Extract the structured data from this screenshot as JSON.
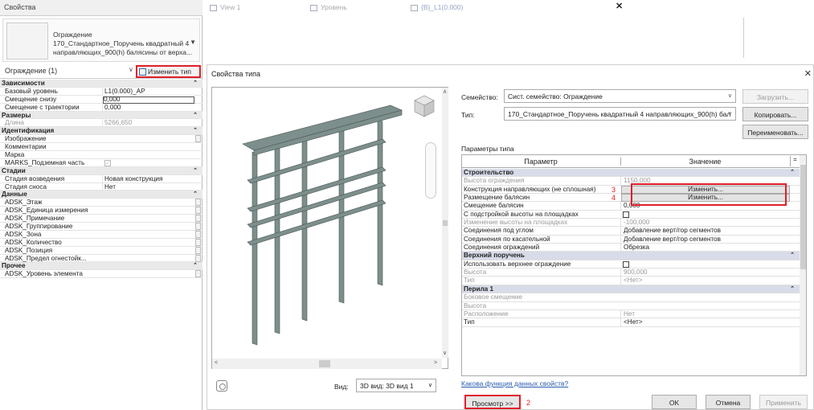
{
  "properties_palette": {
    "title": "Свойства",
    "type_selector": {
      "family": "Ограждение",
      "type_line1": "170_Стандартное_Поручень квадратный 4",
      "type_line2": "направляющих_900(h) балясины от верха..."
    },
    "filter": "Ограждение (1)",
    "edit_type_label": "Изменить тип",
    "edit_type_annotation": "1",
    "rows": [
      {
        "kind": "cat",
        "label": "Зависимости"
      },
      {
        "kind": "row",
        "label": "Базовый уровень",
        "value": "L1(0.000)_AP"
      },
      {
        "kind": "box",
        "label": "Смещение снизу",
        "value": "0,000"
      },
      {
        "kind": "row",
        "label": "Смещение с траектории",
        "value": "0,000"
      },
      {
        "kind": "cat",
        "label": "Размеры"
      },
      {
        "kind": "gray",
        "label": "Длина",
        "value": "5266,650"
      },
      {
        "kind": "cat",
        "label": "Идентификация"
      },
      {
        "kind": "btn",
        "label": "Изображение",
        "value": ""
      },
      {
        "kind": "row",
        "label": "Комментарии",
        "value": ""
      },
      {
        "kind": "row",
        "label": "Марка",
        "value": ""
      },
      {
        "kind": "chk",
        "label": "MARKS_Подземная часть",
        "value": "✓"
      },
      {
        "kind": "cat",
        "label": "Стадии"
      },
      {
        "kind": "row",
        "label": "Стадия возведения",
        "value": "Новая конструкция"
      },
      {
        "kind": "row",
        "label": "Стадия сноса",
        "value": "Нет"
      },
      {
        "kind": "cat",
        "label": "Данные"
      },
      {
        "kind": "btn",
        "label": "ADSK_Этаж",
        "value": ""
      },
      {
        "kind": "btn",
        "label": "ADSK_Единица измерения",
        "value": ""
      },
      {
        "kind": "btn",
        "label": "ADSK_Примечание",
        "value": ""
      },
      {
        "kind": "btn",
        "label": "ADSK_Группирование",
        "value": ""
      },
      {
        "kind": "btn",
        "label": "ADSK_Зона",
        "value": ""
      },
      {
        "kind": "btn",
        "label": "ADSK_Количество",
        "value": ""
      },
      {
        "kind": "btn",
        "label": "ADSK_Позиция",
        "value": ""
      },
      {
        "kind": "btn",
        "label": "ADSK_Предел огнестойк...",
        "value": ""
      },
      {
        "kind": "cat",
        "label": "Прочее"
      },
      {
        "kind": "btn",
        "label": "ADSK_Уровень элемента",
        "value": ""
      }
    ]
  },
  "tabs": [
    {
      "label": "View 1",
      "active": false
    },
    {
      "label": "Уровень",
      "active": false
    },
    {
      "label": "{B}_L1(0.000)",
      "active": true
    }
  ],
  "dialog": {
    "title": "Свойства типа",
    "family_label": "Семейство:",
    "family_value": "Сист. семейство: Ограждение",
    "type_label": "Тип:",
    "type_value": "170_Стандартное_Поручень квадратный 4 направляющих_900(h) бал",
    "load_btn": "Загрузить...",
    "copy_btn": "Копировать...",
    "rename_btn": "Переименовать...",
    "type_params_label": "Параметры типа",
    "col_param": "Параметр",
    "col_value": "Значение",
    "col_eq": "=",
    "params": [
      {
        "kind": "cat",
        "label": "Строительство"
      },
      {
        "kind": "gray",
        "label": "Высота ограждения",
        "value": "1150,000"
      },
      {
        "kind": "btn",
        "label": "Конструкция направляющих (не сплошная)",
        "value": "Изменить...",
        "annotation": "3"
      },
      {
        "kind": "btn",
        "label": "Размещение балясин",
        "value": "Изменить...",
        "annotation": "4"
      },
      {
        "kind": "row",
        "label": "Смещение балясин",
        "value": "0,000"
      },
      {
        "kind": "cbx",
        "label": "С подстройкой высоты на площадках",
        "value": ""
      },
      {
        "kind": "gray",
        "label": "Изменение высоты на площадках",
        "value": "-100,000"
      },
      {
        "kind": "row",
        "label": "Соединения под углом",
        "value": "Добавление верт/гор сегментов"
      },
      {
        "kind": "row",
        "label": "Соединения по касательной",
        "value": "Добавление верт/гор сегментов"
      },
      {
        "kind": "row",
        "label": "Соединения ограждений",
        "value": "Обрезка"
      },
      {
        "kind": "cat",
        "label": "Верхний поручень"
      },
      {
        "kind": "cbx",
        "label": "Использовать верхнее ограждение",
        "value": ""
      },
      {
        "kind": "gray",
        "label": "Высота",
        "value": "900,000"
      },
      {
        "kind": "gray",
        "label": "Тип",
        "value": "<Нет>"
      },
      {
        "kind": "cat",
        "label": "Перила 1"
      },
      {
        "kind": "gray",
        "label": "Боковое смещение",
        "value": ""
      },
      {
        "kind": "gray",
        "label": "Высота",
        "value": ""
      },
      {
        "kind": "gray",
        "label": "Расположение",
        "value": "Нет"
      },
      {
        "kind": "row",
        "label": "Тип",
        "value": "<Нет>"
      }
    ],
    "help_link": "Какова функция данных свойств?",
    "view_label": "Вид:",
    "view_value": "3D вид: 3D вид 1",
    "preview_btn": "Просмотр >>",
    "preview_annotation": "2",
    "ok_btn": "OK",
    "cancel_btn": "Отмена",
    "apply_btn": "Применить"
  }
}
